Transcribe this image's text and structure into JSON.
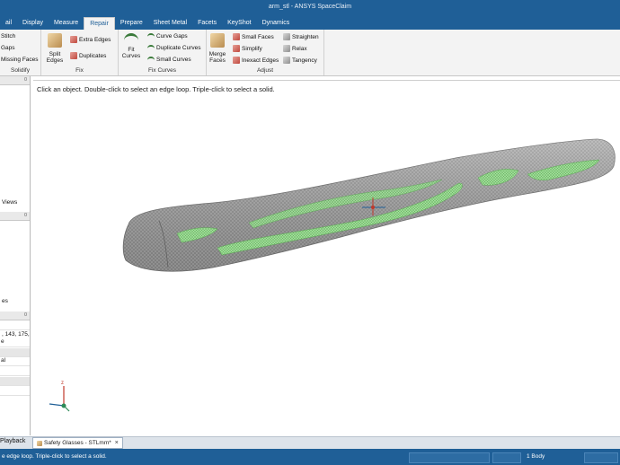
{
  "window": {
    "title": "arm_stl - ANSYS SpaceClaim"
  },
  "tabs": [
    {
      "label": "ail"
    },
    {
      "label": "Display"
    },
    {
      "label": "Measure"
    },
    {
      "label": "Repair",
      "active": true
    },
    {
      "label": "Prepare"
    },
    {
      "label": "Sheet Metal"
    },
    {
      "label": "Facets"
    },
    {
      "label": "KeyShot"
    },
    {
      "label": "Dynamics"
    }
  ],
  "ribbon": {
    "solidify": {
      "label": "Solidify",
      "stitch": "Stitch",
      "gaps": "Gaps",
      "missing_faces": "Missing Faces"
    },
    "fix": {
      "label": "Fix",
      "split_edges": "Split\nEdges",
      "extra_edges": "Extra Edges",
      "duplicates": "Duplicates"
    },
    "fix_curves": {
      "label": "Fix Curves",
      "fit_curves": "Fit\nCurves",
      "curve_gaps": "Curve Gaps",
      "duplicate_curves": "Duplicate Curves",
      "small_curves": "Small Curves"
    },
    "adjust": {
      "label": "Adjust",
      "merge_faces": "Merge\nFaces",
      "small_faces": "Small Faces",
      "simplify": "Simplify",
      "inexact_edges": "Inexact Edges",
      "straighten": "Straighten",
      "relax": "Relax",
      "tangency": "Tangency"
    }
  },
  "left_panel": {
    "views_label": "Views",
    "es_label": "es",
    "coords_text": ", 143, 175,",
    "row_e": "e",
    "row_al": "al"
  },
  "viewport": {
    "hint": "Click an object. Double-click to select an edge loop. Triple-click to select a solid."
  },
  "bottom": {
    "playback": "Playback",
    "doc_tab": "Safety Glasses - STLmm*",
    "doc_close": "×"
  },
  "status": {
    "text": "e edge loop. Triple-click to select a solid.",
    "body_count": "1 Body"
  },
  "colors": {
    "accent": "#1f5f97",
    "mesh": "#9a9a9a",
    "highlight": "#8fd48a"
  }
}
